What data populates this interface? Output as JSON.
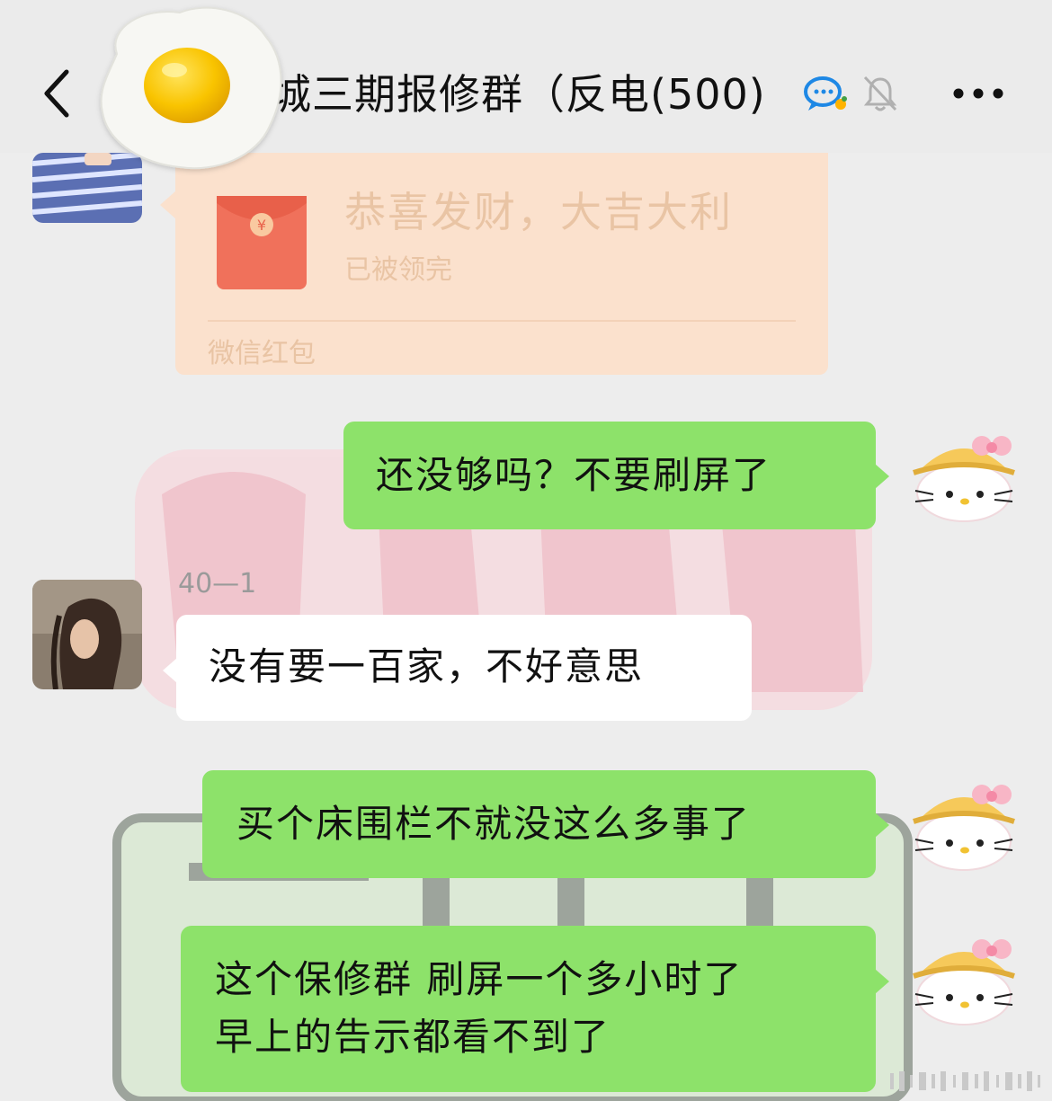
{
  "header": {
    "title": "城三期报修群（反电",
    "member_count": "(500)"
  },
  "icons": {
    "back": "chevron-left-icon",
    "chat": "chat-bubble-icon",
    "mute": "bell-off-icon",
    "more": "more-dots-icon"
  },
  "red_packet": {
    "title": "恭喜发财，大吉大利",
    "status": "已被领完",
    "footer": "微信红包"
  },
  "messages": [
    {
      "side": "right",
      "text": "还没够吗？不要刷屏了"
    },
    {
      "side": "left",
      "sender": "40—1",
      "text": "没有要一百家，不好意思"
    },
    {
      "side": "right",
      "text": "买个床围栏不就没这么多事了"
    },
    {
      "side": "right",
      "lines": [
        "这个保修群 刷屏一个多小时了",
        "早上的告示都看不到了"
      ]
    }
  ],
  "colors": {
    "header_bg": "#ebebeb",
    "chat_bg": "#ededed",
    "green_bubble": "#8de26a",
    "white_bubble": "#ffffff",
    "packet_bg": "#fbe1cd",
    "packet_text": "#e9c4a4"
  }
}
